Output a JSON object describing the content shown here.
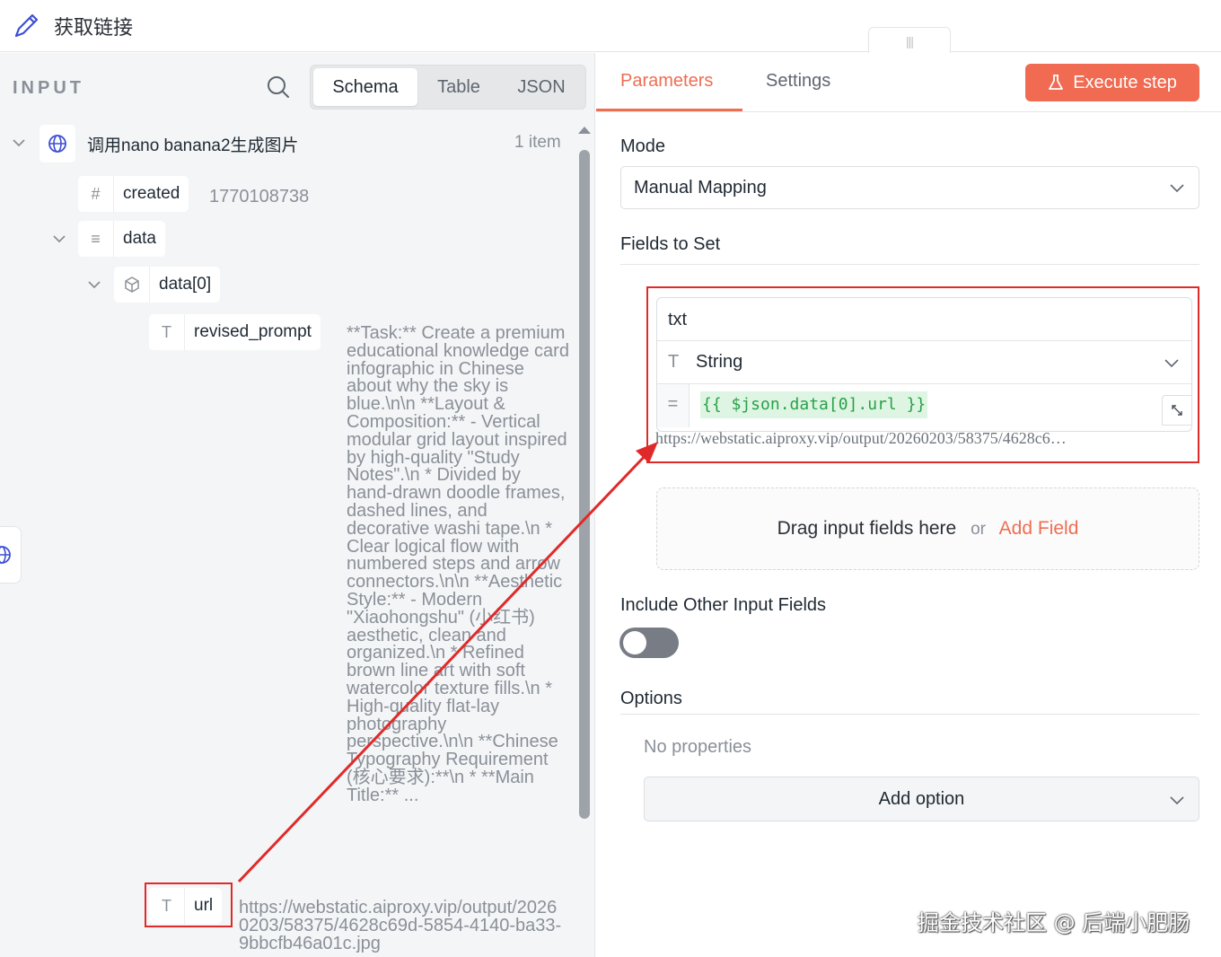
{
  "header": {
    "title": "获取链接",
    "handle_glyph": "|||"
  },
  "input_panel": {
    "label": "INPUT",
    "view_options": [
      "Schema",
      "Table",
      "JSON"
    ],
    "active_view": "Schema",
    "node": {
      "title": "调用nano banana2生成图片",
      "count": "1 item"
    },
    "fields": {
      "created": {
        "name": "created",
        "type_icon": "#",
        "value": "1770108738"
      },
      "data": {
        "name": "data",
        "type_icon": "≡"
      },
      "data0": {
        "name": "data[0]"
      },
      "revised_prompt": {
        "name": "revised_prompt",
        "type_icon": "T",
        "value": "**Task:** Create a premium educational knowledge card infographic in Chinese about why the sky is blue.\\n\\n **Layout & Composition:** - Vertical modular grid layout inspired by high-quality \"Study Notes\".\\n * Divided by hand-drawn doodle frames, dashed lines, and decorative washi tape.\\n * Clear logical flow with numbered steps and arrow connectors.\\n\\n **Aesthetic Style:** - Modern \"Xiaohongshu\" (小红书) aesthetic, clean and organized.\\n * Refined brown line art with soft watercolor texture fills.\\n * High-quality flat-lay photography perspective.\\n\\n **Chinese Typography Requirement (核心要求):**\\n * **Main Title:** ..."
      },
      "url": {
        "name": "url",
        "type_icon": "T",
        "value": "https://webstatic.aiproxy.vip/output/20260203/58375/4628c69d-5854-4140-ba33-9bbcfb46a01c.jpg"
      }
    }
  },
  "params_panel": {
    "tabs": [
      "Parameters",
      "Settings"
    ],
    "active_tab": "Parameters",
    "execute_label": "Execute step",
    "mode_label": "Mode",
    "mode_value": "Manual Mapping",
    "fields_to_set_label": "Fields to Set",
    "field": {
      "name": "txt",
      "type": "String",
      "expression": "{{ $json.data[0].url }}",
      "preview": "https://webstatic.aiproxy.vip/output/20260203/58375/4628c6…"
    },
    "drop_zone": {
      "text": "Drag input fields here",
      "or": "or",
      "add_field": "Add Field"
    },
    "include_other_label": "Include Other Input Fields",
    "include_other_enabled": false,
    "options_label": "Options",
    "no_properties": "No properties",
    "add_option_label": "Add option"
  },
  "watermark": "掘金技术社区 @ 后端小肥肠",
  "colors": {
    "accent": "#ee6e53",
    "annotation": "#e02a2a",
    "expr_bg": "#dff5e3",
    "expr_text": "#27a148"
  }
}
